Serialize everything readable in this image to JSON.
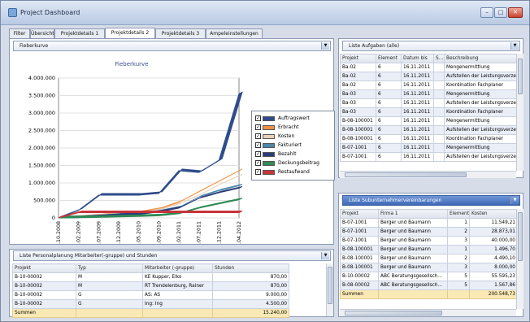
{
  "window": {
    "title": "Project Dashboard",
    "btn_min": "–",
    "btn_max": "□",
    "btn_close": "✕"
  },
  "tabs": [
    "Filter",
    "Übersicht",
    "Projektdetails 1",
    "Projektdetails 2",
    "Projektdetails 3",
    "Ampeleinstellungen"
  ],
  "active_tab": "Projektdetails 2",
  "chart_panel": {
    "combo_value": "Fieberkurve"
  },
  "chart_data": {
    "type": "line",
    "title": "Fieberkurve",
    "ylim": [
      0,
      4000000
    ],
    "yticks": [
      "0",
      "500.000",
      "1.000.000",
      "1.500.000",
      "2.000.000",
      "2.500.000",
      "3.000.000",
      "3.500.000",
      "4.000.000"
    ],
    "categories": [
      "01.10.2008",
      "23.02.2009",
      "18.07.2009",
      "10.12.2009",
      "04.05.2010",
      "25.09.2010",
      "17.02.2011",
      "12.07.2011",
      "04.12.2011",
      "27.04.2012"
    ],
    "series": [
      {
        "name": "Auftragswert",
        "color": "#2f4c8a",
        "values": [
          0,
          220000,
          650000,
          650000,
          650000,
          700000,
          1350000,
          1300000,
          1650000,
          3550000
        ]
      },
      {
        "name": "Erbracht",
        "color": "#f09040",
        "values": [
          0,
          20000,
          60000,
          120000,
          150000,
          250000,
          450000,
          750000,
          1050000,
          1350000
        ]
      },
      {
        "name": "Kosten",
        "color": "#e8d2b8",
        "values": [
          0,
          15000,
          50000,
          100000,
          120000,
          220000,
          400000,
          650000,
          950000,
          1200000
        ]
      },
      {
        "name": "Fakturiert",
        "color": "#4e86a6",
        "values": [
          0,
          10000,
          40000,
          80000,
          100000,
          180000,
          300000,
          600000,
          780000,
          920000
        ]
      },
      {
        "name": "Bezahlt",
        "color": "#2a3c7a",
        "values": [
          0,
          10000,
          35000,
          75000,
          95000,
          170000,
          280000,
          560000,
          720000,
          850000
        ]
      },
      {
        "name": "Deckungsbeitrag",
        "color": "#2f8a55",
        "values": [
          0,
          5000,
          15000,
          30000,
          40000,
          60000,
          120000,
          280000,
          400000,
          520000
        ]
      },
      {
        "name": "Restaufwand",
        "color": "#c8343a",
        "values": [
          0,
          150000,
          150000,
          150000,
          150000,
          150000,
          150000,
          150000,
          150000,
          150000
        ]
      }
    ],
    "legend": "inside-right"
  },
  "personnel": {
    "combo_value": "Liste Personalplanung Mitarbeiter(-gruppe) und Stunden",
    "columns": [
      "Projekt",
      "Typ",
      "Mitarbeiter (-gruppe)",
      "Stunden"
    ],
    "rows": [
      [
        "B-10-00002",
        "M",
        "KE Kupper, Elko",
        "870,00"
      ],
      [
        "B-10-00002",
        "M",
        "RT Trendelenburg, Rainer",
        "870,00"
      ],
      [
        "B-10-00002",
        "G",
        "AS: AS",
        "9.000,00"
      ],
      [
        "B-10-00002",
        "G",
        "Ing: Ing",
        "4.500,00"
      ]
    ],
    "sum_label": "Summen",
    "sum_value": "15.240,00"
  },
  "tasks": {
    "combo_value": "Liste Aufgaben (alle)",
    "columns": [
      "Projekt",
      "Element",
      "Datum bis",
      "S...",
      "Beschreibung"
    ],
    "rows": [
      [
        "Ba-02",
        "6",
        "16.11.2011",
        "",
        "Mengenermittlung"
      ],
      [
        "Ba-02",
        "6",
        "16.11.2011",
        "",
        "Aufstellen der Leistungsverze"
      ],
      [
        "Ba-02",
        "6",
        "16.11.2011",
        "",
        "Koordination Fachplaner"
      ],
      [
        "Ba-03",
        "6",
        "16.11.2011",
        "",
        "Mengenermittlung"
      ],
      [
        "Ba-03",
        "6",
        "16.11.2011",
        "",
        "Aufstellen der Leistungsverze"
      ],
      [
        "Ba-03",
        "6",
        "16.11.2011",
        "",
        "Koordination Fachplaner"
      ],
      [
        "B-08-100001",
        "6",
        "16.11.2011",
        "",
        "Mengenermittlung"
      ],
      [
        "B-08-100001",
        "6",
        "16.11.2011",
        "",
        "Aufstellen der Leistungsverze"
      ],
      [
        "B-08-100001",
        "6",
        "16.11.2011",
        "",
        "Koordination Fachplaner"
      ],
      [
        "B-07-1001",
        "6",
        "16.11.2011",
        "",
        "Mengenermittlung"
      ],
      [
        "B-07-1001",
        "6",
        "16.11.2011",
        "",
        "Aufstellen der Leistungsverze"
      ]
    ]
  },
  "subcontractors": {
    "combo_value": "Liste Subunternehmervereinbarungen",
    "columns": [
      "Projekt",
      "Firma 1",
      "Element",
      "Kosten"
    ],
    "rows": [
      [
        "B-07-1001",
        "Berger und Baumann",
        "1",
        "11.549,21"
      ],
      [
        "B-07-1001",
        "Berger und Baumann",
        "2",
        "28.873,01"
      ],
      [
        "B-07-1001",
        "Berger und Baumann",
        "3",
        "40.000,00"
      ],
      [
        "B-08-100001",
        "Berger und Baumann",
        "1",
        "1.496,70"
      ],
      [
        "B-08-100001",
        "Berger und Baumann",
        "2",
        "4.490,10"
      ],
      [
        "B-08-100001",
        "Berger und Baumann",
        "3",
        "8.000,00"
      ],
      [
        "B-10-00002",
        "ABC Beratungsgesellsch...",
        "5",
        "55.595,23"
      ],
      [
        "B-08-00002",
        "ABC Beratungsgesellsch...",
        "5",
        "1.567,86"
      ]
    ],
    "sum_label": "Summen",
    "sum_value": "200.548,73"
  }
}
